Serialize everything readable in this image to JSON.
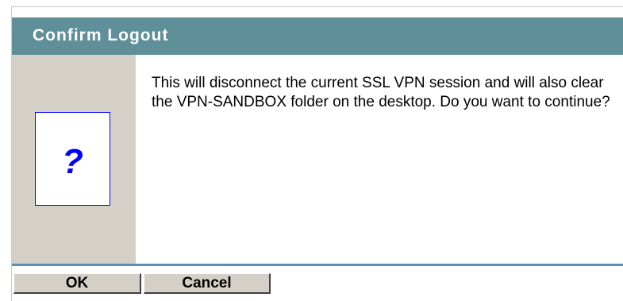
{
  "dialog": {
    "title": "Confirm Logout",
    "icon": "question-icon",
    "icon_glyph": "?",
    "message": "This will disconnect the current SSL VPN session and will also clear the VPN-SANDBOX folder on the desktop. Do you want to continue?"
  },
  "buttons": {
    "ok_label": "OK",
    "cancel_label": "Cancel"
  },
  "colors": {
    "title_bar": "#5f8f98",
    "icon_pane": "#d4d0c8",
    "icon_accent": "#0000ff",
    "separator": "#5b8fb4"
  }
}
